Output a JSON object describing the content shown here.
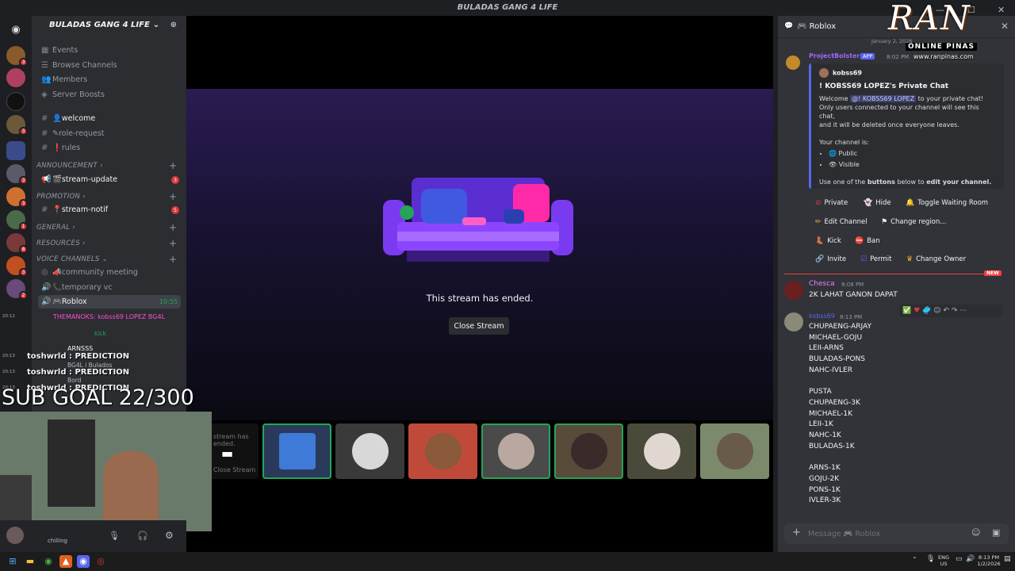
{
  "window": {
    "title": "BULADAS GANG 4 LIFE"
  },
  "guild": {
    "name": "BULADAS GANG 4 LIFE"
  },
  "sidebar_top": [
    {
      "icon": "calendar-icon",
      "label": "Events"
    },
    {
      "icon": "browse-icon",
      "label": "Browse Channels"
    },
    {
      "icon": "members-icon",
      "label": "Members"
    },
    {
      "icon": "boost-icon",
      "label": "Server Boosts"
    }
  ],
  "channels": {
    "welcome": "welcome",
    "role_request": "role-request",
    "rules": "rules",
    "cat_announcement": "ANNOUNCEMENT",
    "stream_update": "stream-update",
    "stream_update_badge": "3",
    "cat_promotion": "PROMOTION",
    "stream_notif": "stream-notif",
    "stream_notif_badge": "5",
    "cat_general": "GENERAL",
    "cat_resources": "RESOURCES",
    "cat_voice": "VOICE CHANNELS",
    "community_meeting": "community meeting",
    "temporary_vc": "temporary vc",
    "roblox": "Roblox",
    "roblox_time": "10:55"
  },
  "server_badges": [
    "3",
    "3",
    "3",
    "3",
    "1",
    "8",
    "3",
    "2"
  ],
  "overlay": {
    "line1": "THEMANOKS: kobss69 LOPEZ BG4L",
    "kick": "kick",
    "arnsss": "ARNSSS",
    "bg4l_line": "BG4L i Bulados",
    "pred1": "toshwrld : PREDICTION",
    "pred2": "toshwrld : PREDICTION",
    "pred3": "toshwrld : PREDICTION",
    "bord": "Bord",
    "t1": "20:12",
    "t2": "20:13",
    "t3": "20:13",
    "t4": "20:13",
    "subgoal": "SUB GOAL 22/300",
    "status": "chilling"
  },
  "stage": {
    "message": "This stream has ended.",
    "close_button": "Close Stream",
    "mini_msg": "stream has ended.",
    "mini_close": "Close Stream"
  },
  "chat": {
    "header": "Roblox",
    "date": "January 2, 2026",
    "bot_name": "ProjectBolster",
    "bot_tag": "APP",
    "bot_time": "8:02 PM",
    "embed_author": "kobss69",
    "embed_title": "! KOBSS69 LOPEZ's Private Chat",
    "embed_welcome_pre": "Welcome",
    "embed_mention": "@! KOBSS69 LOPEZ",
    "embed_welcome_post": "to your private chat!",
    "embed_line2": "Only users connected to your channel will see this chat,",
    "embed_line3": "and it will be deleted once everyone leaves.",
    "embed_status_label": "Your channel is:",
    "embed_status1": "Public",
    "embed_status2": "Visible",
    "embed_footer_pre": "Use one of the",
    "embed_footer_b1": "buttons",
    "embed_footer_mid": "below to",
    "embed_footer_b2": "edit your channel.",
    "buttons": {
      "private": "Private",
      "hide": "Hide",
      "waiting": "Toggle Waiting Room",
      "edit": "Edit Channel",
      "region": "Change region...",
      "kick": "Kick",
      "ban": "Ban",
      "invite": "Invite",
      "permit": "Permit",
      "owner": "Change Owner"
    },
    "new_label": "NEW",
    "msg1_name": "Chesca",
    "msg1_time": "8:08 PM",
    "msg1_text": "2K LAHAT GANON DAPAT",
    "msg2_name": "kobss69",
    "msg2_time": "8:13 PM",
    "msg2_text": "CHUPAENG-ARJAY\nMICHAEL-GOJU\nLEII-ARNS\nBULADAS-PONS\nNAHC-IVLER\n\nPUSTA\nCHUPAENG-3K\nMICHAEL-1K\nLEII-1K\nNAHC-1K\nBULADAS-1K\n\nARNS-1K\nGOJU-2K\nPONS-1K\nIVLER-3K",
    "composer_placeholder": "Message 🎮 Roblox"
  },
  "logo": {
    "line1": "RAN",
    "line2": "ONLINE PINAS",
    "line3": "www.ranpinas.com"
  },
  "taskbar": {
    "lang1": "ENG",
    "lang2": "US",
    "time": "8:13 PM",
    "date": "1/2/2026"
  },
  "colors": {
    "accent": "#5865f2",
    "online": "#23a55a",
    "danger": "#da373c",
    "chesca": "#f47fff"
  }
}
